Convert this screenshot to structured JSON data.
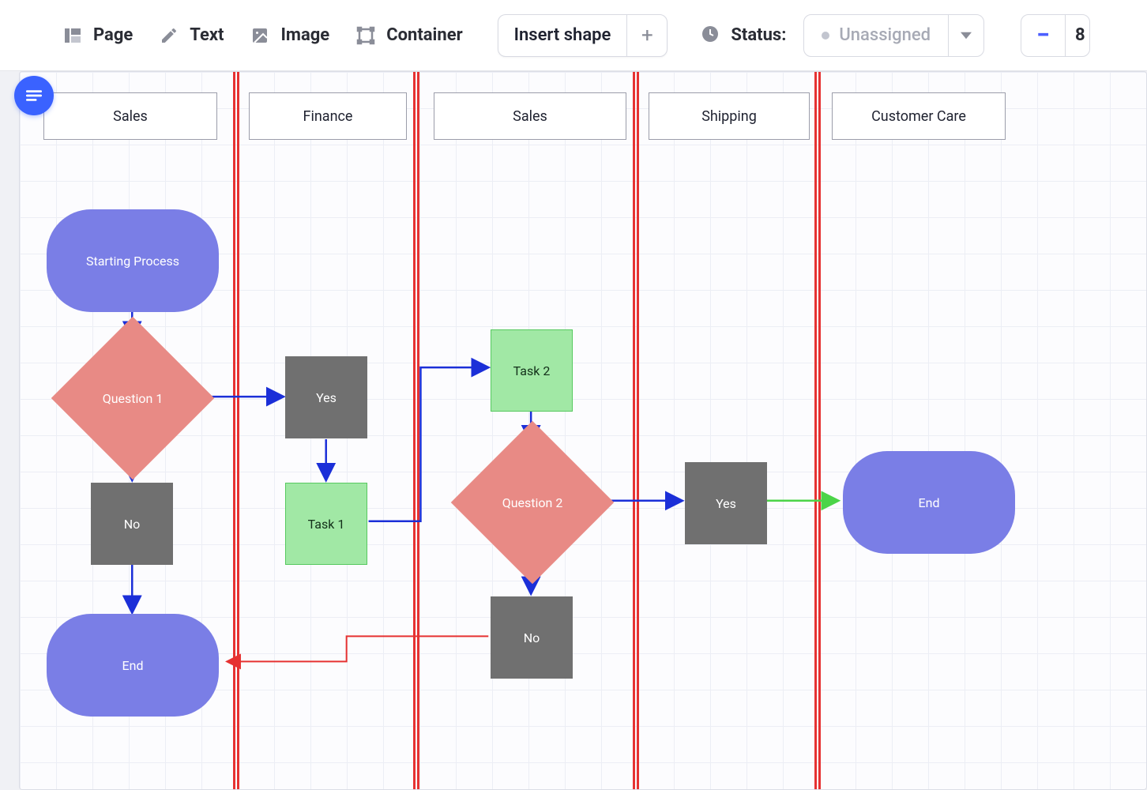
{
  "toolbar": {
    "page_label": "Page",
    "text_label": "Text",
    "image_label": "Image",
    "container_label": "Container",
    "insert_shape_label": "Insert shape",
    "status_label": "Status:",
    "status_value": "Unassigned",
    "zoom_value": "8"
  },
  "lanes": [
    {
      "id": "lane-sales-1",
      "label": "Sales"
    },
    {
      "id": "lane-finance",
      "label": "Finance"
    },
    {
      "id": "lane-sales-2",
      "label": "Sales"
    },
    {
      "id": "lane-shipping",
      "label": "Shipping"
    },
    {
      "id": "lane-customer-care",
      "label": "Customer Care"
    }
  ],
  "nodes": {
    "start": {
      "label": "Starting Process",
      "type": "terminator",
      "lane": "lane-sales-1"
    },
    "q1": {
      "label": "Question 1",
      "type": "decision",
      "lane": "lane-sales-1"
    },
    "no1": {
      "label": "No",
      "type": "process-grey",
      "lane": "lane-sales-1"
    },
    "end1": {
      "label": "End",
      "type": "terminator",
      "lane": "lane-sales-1"
    },
    "yes1": {
      "label": "Yes",
      "type": "process-grey",
      "lane": "lane-finance"
    },
    "task1": {
      "label": "Task 1",
      "type": "process-green",
      "lane": "lane-finance"
    },
    "task2": {
      "label": "Task 2",
      "type": "process-green",
      "lane": "lane-sales-2"
    },
    "q2": {
      "label": "Question 2",
      "type": "decision",
      "lane": "lane-sales-2"
    },
    "no2": {
      "label": "No",
      "type": "process-grey",
      "lane": "lane-sales-2"
    },
    "yes2": {
      "label": "Yes",
      "type": "process-grey",
      "lane": "lane-shipping"
    },
    "end2": {
      "label": "End",
      "type": "terminator",
      "lane": "lane-customer-care"
    }
  },
  "edges": [
    {
      "from": "start",
      "to": "q1",
      "color": "blue"
    },
    {
      "from": "q1",
      "to": "no1",
      "color": "blue",
      "branch": "No"
    },
    {
      "from": "q1",
      "to": "yes1",
      "color": "blue",
      "branch": "Yes"
    },
    {
      "from": "yes1",
      "to": "task1",
      "color": "blue"
    },
    {
      "from": "task1",
      "to": "task2",
      "via": "elbow",
      "color": "blue"
    },
    {
      "from": "task2",
      "to": "q2",
      "color": "blue"
    },
    {
      "from": "q2",
      "to": "yes2",
      "color": "blue",
      "branch": "Yes"
    },
    {
      "from": "q2",
      "to": "no2",
      "color": "blue",
      "branch": "No"
    },
    {
      "from": "no1",
      "to": "end1",
      "color": "blue"
    },
    {
      "from": "no2",
      "to": "end1",
      "via": "elbow",
      "color": "red"
    },
    {
      "from": "yes2",
      "to": "end2",
      "color": "green"
    }
  ],
  "colors": {
    "terminator_fill": "#7a7ee6",
    "decision_fill": "#e88a85",
    "process_grey": "#707070",
    "process_green": "#a1e8a5",
    "lane_separator": "#e63232",
    "arrow_blue": "#1b2fd8",
    "arrow_red": "#e63232",
    "arrow_green": "#4bd448",
    "accent_blue": "#3a62ff"
  }
}
